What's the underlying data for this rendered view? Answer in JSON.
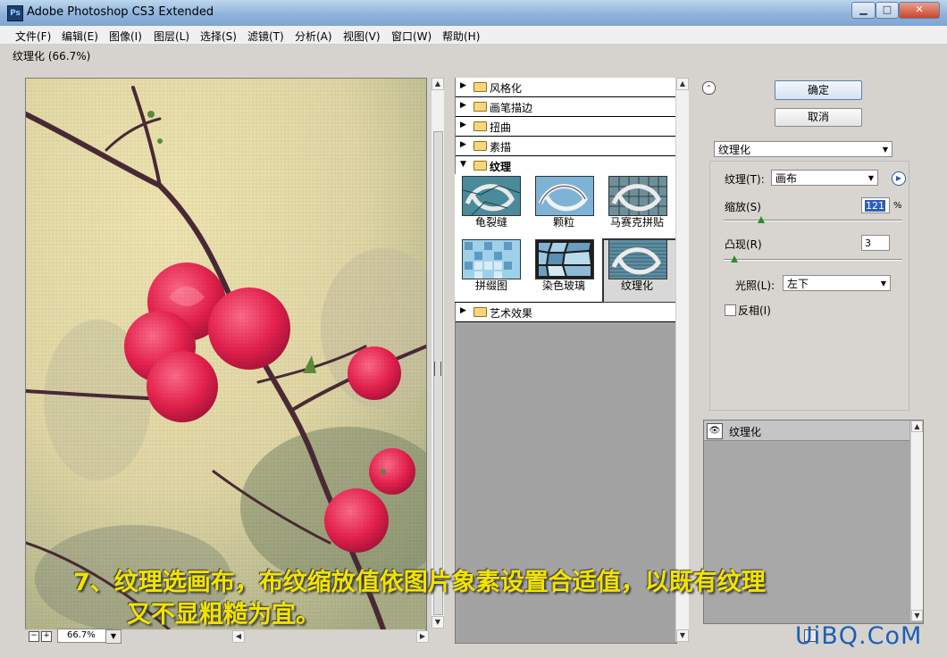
{
  "window": {
    "title": "Adobe Photoshop CS3 Extended",
    "app_icon": "Ps"
  },
  "menu": [
    "文件(F)",
    "编辑(E)",
    "图像(I)",
    "图层(L)",
    "选择(S)",
    "滤镜(T)",
    "分析(A)",
    "视图(V)",
    "窗口(W)",
    "帮助(H)"
  ],
  "dialog": {
    "title": "纹理化 (66.7%)"
  },
  "preview": {
    "zoom": "66.7%",
    "zoom_minus": "−",
    "zoom_plus": "+"
  },
  "gallery": {
    "folders_top": [
      {
        "label": "风格化",
        "expanded": false
      },
      {
        "label": "画笔描边",
        "expanded": false
      },
      {
        "label": "扭曲",
        "expanded": false
      },
      {
        "label": "素描",
        "expanded": false
      },
      {
        "label": "纹理",
        "expanded": true
      }
    ],
    "filters": [
      "龟裂缝",
      "颗粒",
      "马赛克拼贴",
      "拼缀图",
      "染色玻璃",
      "纹理化"
    ],
    "selected_filter": "纹理化",
    "folder_bottom": {
      "label": "艺术效果",
      "expanded": false
    }
  },
  "buttons": {
    "ok": "确定",
    "cancel": "取消"
  },
  "filter_select": "纹理化",
  "settings": {
    "texture_label": "纹理(T):",
    "texture_value": "画布",
    "scaling_label": "缩放(S)",
    "scaling_value": "121",
    "scaling_unit": "%",
    "scaling_fraction": 0.21,
    "relief_label": "凸现(R)",
    "relief_value": "3",
    "relief_fraction": 0.06,
    "light_label": "光照(L):",
    "light_value": "左下",
    "invert_label": "反相(I)",
    "invert_checked": false
  },
  "layers": {
    "effect_name": "纹理化"
  },
  "caption": {
    "line1": "7、纹理选画布，布纹缩放值依图片象素设置合适值，以既有纹理",
    "line2": "又不显粗糙为宜。"
  },
  "watermark": "UiBQ.CoM"
}
